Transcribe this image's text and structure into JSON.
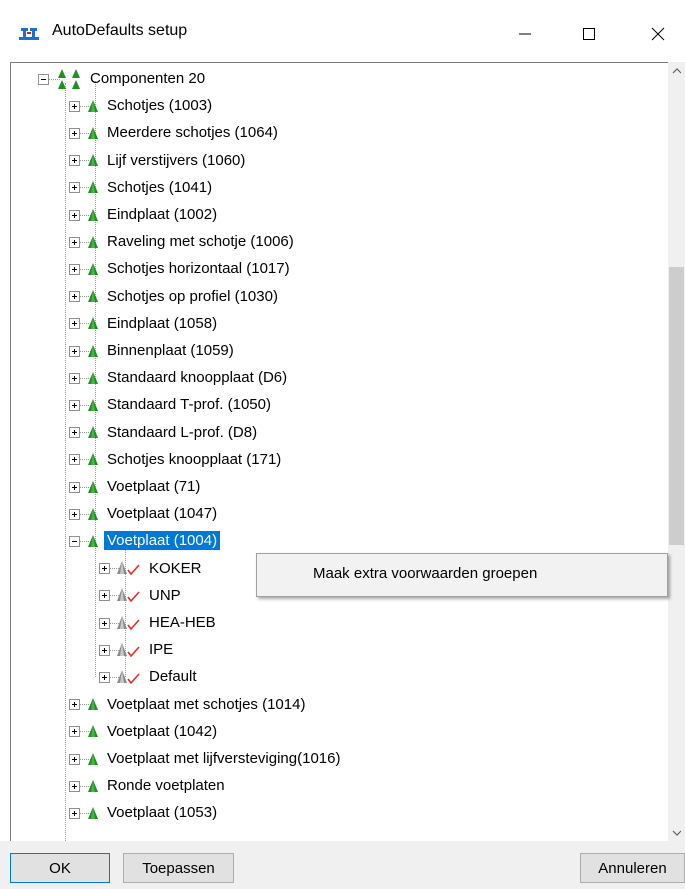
{
  "window": {
    "title": "AutoDefaults setup",
    "controls": {
      "minimize": "—",
      "maximize": "☐",
      "close": "✕"
    }
  },
  "tree": {
    "root": {
      "label": "Componenten 20",
      "expanded": true
    },
    "items": [
      {
        "label": "Schotjes (1003)"
      },
      {
        "label": "Meerdere schotjes (1064)"
      },
      {
        "label": "Lijf verstijvers (1060)"
      },
      {
        "label": "Schotjes (1041)"
      },
      {
        "label": "Eindplaat (1002)"
      },
      {
        "label": "Raveling met schotje (1006)"
      },
      {
        "label": "Schotjes horizontaal (1017)"
      },
      {
        "label": "Schotjes op profiel (1030)"
      },
      {
        "label": "Eindplaat (1058)"
      },
      {
        "label": "Binnenplaat (1059)"
      },
      {
        "label": "Standaard knoopplaat (D6)"
      },
      {
        "label": "Standaard T-prof. (1050)"
      },
      {
        "label": "Standaard L-prof. (D8)"
      },
      {
        "label": "Schotjes knoopplaat (171)"
      },
      {
        "label": "Voetplaat (71)"
      },
      {
        "label": "Voetplaat (1047)"
      },
      {
        "label": "Voetplaat (1004)",
        "selected": true,
        "expanded": true
      },
      {
        "label": "Voetplaat met schotjes (1014)"
      },
      {
        "label": "Voetplaat (1042)"
      },
      {
        "label": "Voetplaat met lijfversteviging(1016)"
      },
      {
        "label": "Ronde voetplaten"
      },
      {
        "label": "Voetplaat (1053)"
      }
    ],
    "children": [
      {
        "label": "KOKER"
      },
      {
        "label": "UNP"
      },
      {
        "label": "HEA-HEB"
      },
      {
        "label": "IPE"
      },
      {
        "label": "Default"
      }
    ]
  },
  "context_menu": {
    "item": "Maak extra voorwaarden groepen"
  },
  "buttons": {
    "ok": "OK",
    "apply": "Toepassen",
    "cancel": "Annuleren"
  },
  "colors": {
    "selection": "#0078d7",
    "node_green": "#1f8f1f",
    "check_red": "#e03020"
  }
}
